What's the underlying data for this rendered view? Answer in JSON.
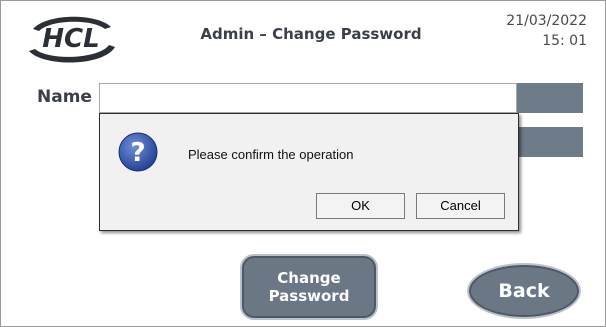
{
  "header": {
    "logo_text": "HCL",
    "title": "Admin – Change Password",
    "date": "21/03/2022",
    "time": "15: 01"
  },
  "form": {
    "name_label": "Name",
    "name_value": ""
  },
  "dialog": {
    "icon": "question-icon",
    "message": "Please confirm the operation",
    "ok_label": "OK",
    "cancel_label": "Cancel"
  },
  "buttons": {
    "change_password_label": "Change\nPassword",
    "back_label": "Back"
  },
  "colors": {
    "button_fill": "#6b7785",
    "dialog_bg": "#f1f1f1",
    "icon_blue": "#2c4fa3"
  }
}
